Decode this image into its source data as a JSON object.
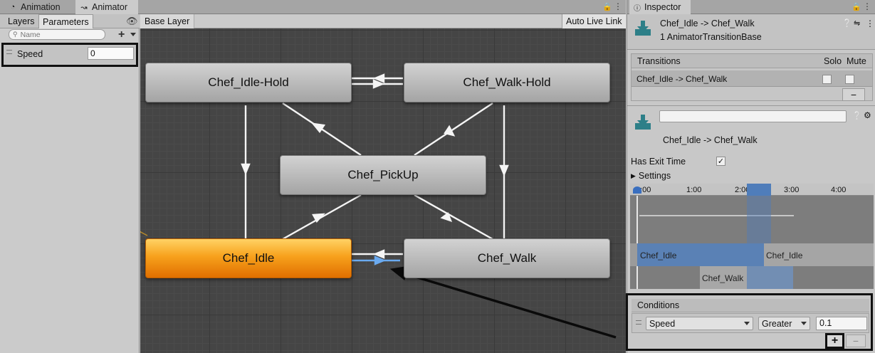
{
  "tabs": {
    "animation": "Animation",
    "animator": "Animator",
    "inspector": "Inspector"
  },
  "left": {
    "layers_tab": "Layers",
    "parameters_tab": "Parameters",
    "search_placeholder": "Name",
    "params": [
      {
        "name": "Speed",
        "value": "0"
      }
    ]
  },
  "graph": {
    "breadcrumb": "Base Layer",
    "auto_live_link": "Auto Live Link",
    "states": {
      "idle_hold": "Chef_Idle-Hold",
      "walk_hold": "Chef_Walk-Hold",
      "pickup": "Chef_PickUp",
      "idle": "Chef_Idle",
      "walk": "Chef_Walk"
    }
  },
  "inspector": {
    "title": "Chef_Idle -> Chef_Walk",
    "subtitle": "1 AnimatorTransitionBase",
    "transitions_header": "Transitions",
    "solo_label": "Solo",
    "mute_label": "Mute",
    "transition_row": "Chef_Idle -> Chef_Walk",
    "minus": "−",
    "name_field": "",
    "transition_name": "Chef_Idle -> Chef_Walk",
    "has_exit_time_label": "Has Exit Time",
    "has_exit_time_check": "✓",
    "settings_label": "Settings",
    "timeline": {
      "ticks": [
        "0:00",
        "1:00",
        "2:00",
        "3:00",
        "4:00"
      ],
      "clip_a": "Chef_Idle",
      "clip_b": "Chef_Idle",
      "clip_c": "Chef_Walk"
    },
    "conditions": {
      "header": "Conditions",
      "parameter": "Speed",
      "operator": "Greater",
      "value": "0.1",
      "plus": "+",
      "minus": "−"
    }
  },
  "colors": {
    "default_state": "#f7a11c",
    "highlight_blue": "#4f7dba",
    "graph_bg": "#454545"
  }
}
